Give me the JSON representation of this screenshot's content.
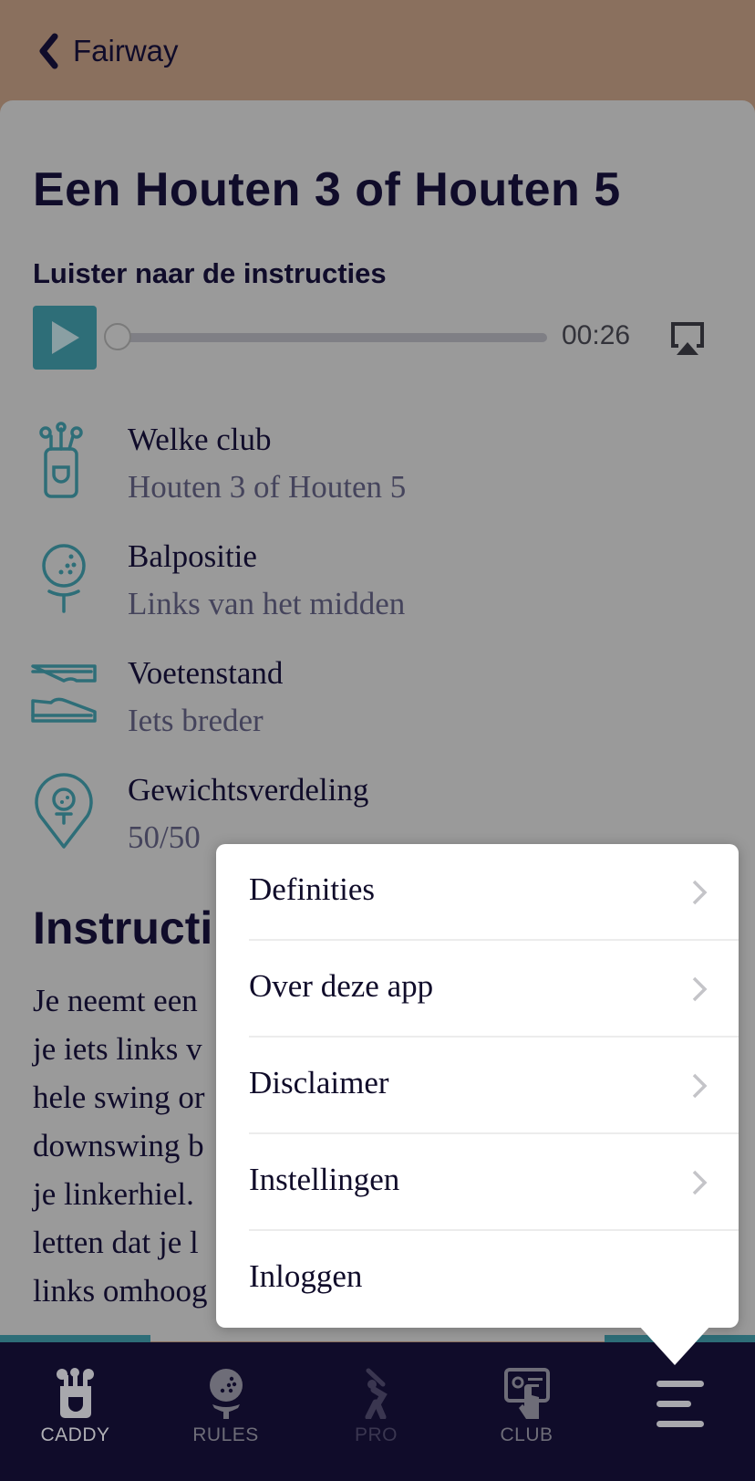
{
  "nav": {
    "back_label": "Fairway",
    "back_icon": "chevron-left-icon"
  },
  "page": {
    "title": "Een Houten 3 of Houten 5",
    "audio": {
      "heading": "Luister naar de instructies",
      "duration": "00:26",
      "progress": 0,
      "play_icon": "play-icon",
      "airplay_icon": "airplay-icon"
    },
    "info": [
      {
        "icon": "golf-bag-icon",
        "label": "Welke club",
        "value": "Houten 3 of Houten 5"
      },
      {
        "icon": "golf-ball-tee-icon",
        "label": "Balpositie",
        "value": "Links van het midden"
      },
      {
        "icon": "golf-shoes-icon",
        "label": "Voetenstand",
        "value": "Iets breder"
      },
      {
        "icon": "location-pin-ball-icon",
        "label": "Gewichtsverdeling",
        "value": "50/50"
      }
    ],
    "instructions_heading": "Instructi",
    "instructions_lines": [
      "Je neemt een",
      "je iets links v",
      "hele swing or",
      "downswing b",
      "je linkerhiel.",
      "letten dat je l",
      "links omhoog gaat richting de finish. Probe"
    ]
  },
  "menu": {
    "items": [
      {
        "label": "Definities",
        "chevron": true
      },
      {
        "label": "Over deze app",
        "chevron": true
      },
      {
        "label": "Disclaimer",
        "chevron": true
      },
      {
        "label": "Instellingen",
        "chevron": true
      },
      {
        "label": "Inloggen",
        "chevron": false
      }
    ]
  },
  "tabbar": {
    "tabs": [
      {
        "label": "CADDY",
        "icon": "golf-bag-icon",
        "state": "active"
      },
      {
        "label": "RULES",
        "icon": "golf-ball-tee-icon",
        "state": "normal"
      },
      {
        "label": "PRO",
        "icon": "golfer-swing-icon",
        "state": "disabled"
      },
      {
        "label": "CLUB",
        "icon": "club-card-icon",
        "state": "normal"
      },
      {
        "label": "",
        "icon": "hamburger-menu-icon",
        "state": "open"
      }
    ]
  },
  "colors": {
    "accent": "#2e6e78",
    "navy": "#100c2a",
    "header_bg": "#8a705e",
    "overlay_bg": "#9a9a9a"
  }
}
